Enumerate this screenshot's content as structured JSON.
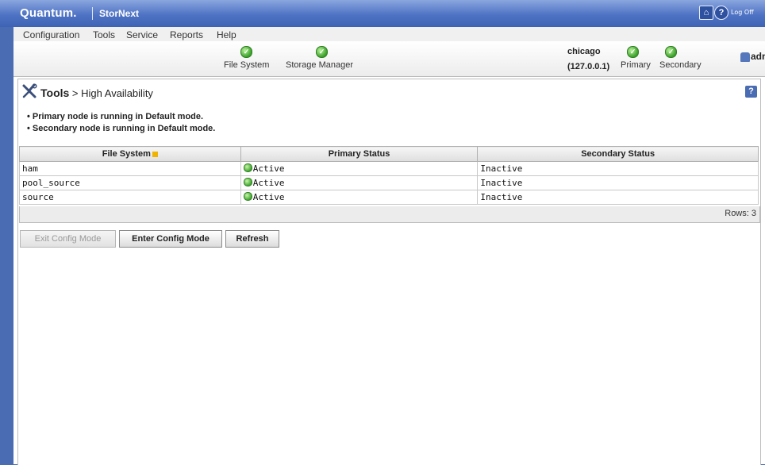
{
  "header": {
    "brand": "Quantum.",
    "product": "StorNext",
    "home_icon": "home-icon",
    "help_icon": "help-icon",
    "logoff_label": "Log Off"
  },
  "menu": {
    "items": [
      "Configuration",
      "Tools",
      "Service",
      "Reports",
      "Help"
    ]
  },
  "status": {
    "file_system": "File System",
    "storage_manager": "Storage Manager",
    "host": "chicago",
    "ip": "(127.0.0.1)",
    "primary": "Primary",
    "secondary": "Secondary",
    "user": "admin"
  },
  "page": {
    "section": "Tools",
    "breadcrumb_sep": " > ",
    "title": "High Availability",
    "messages": [
      "Primary node is running in Default mode.",
      "Secondary node is running in Default mode."
    ]
  },
  "table": {
    "columns": [
      "File System",
      "Primary Status",
      "Secondary Status"
    ],
    "rows": [
      {
        "fs": "ham",
        "primary": "Active",
        "secondary": "Inactive"
      },
      {
        "fs": "pool_source",
        "primary": "Active",
        "secondary": "Inactive"
      },
      {
        "fs": "source",
        "primary": "Active",
        "secondary": "Inactive"
      }
    ],
    "rows_count": "Rows: 3"
  },
  "buttons": {
    "exit_config": "Exit Config Mode",
    "enter_config": "Enter Config Mode",
    "refresh": "Refresh"
  },
  "colors": {
    "header_blue": "#4f73c4",
    "status_green": "#3aa12a"
  }
}
